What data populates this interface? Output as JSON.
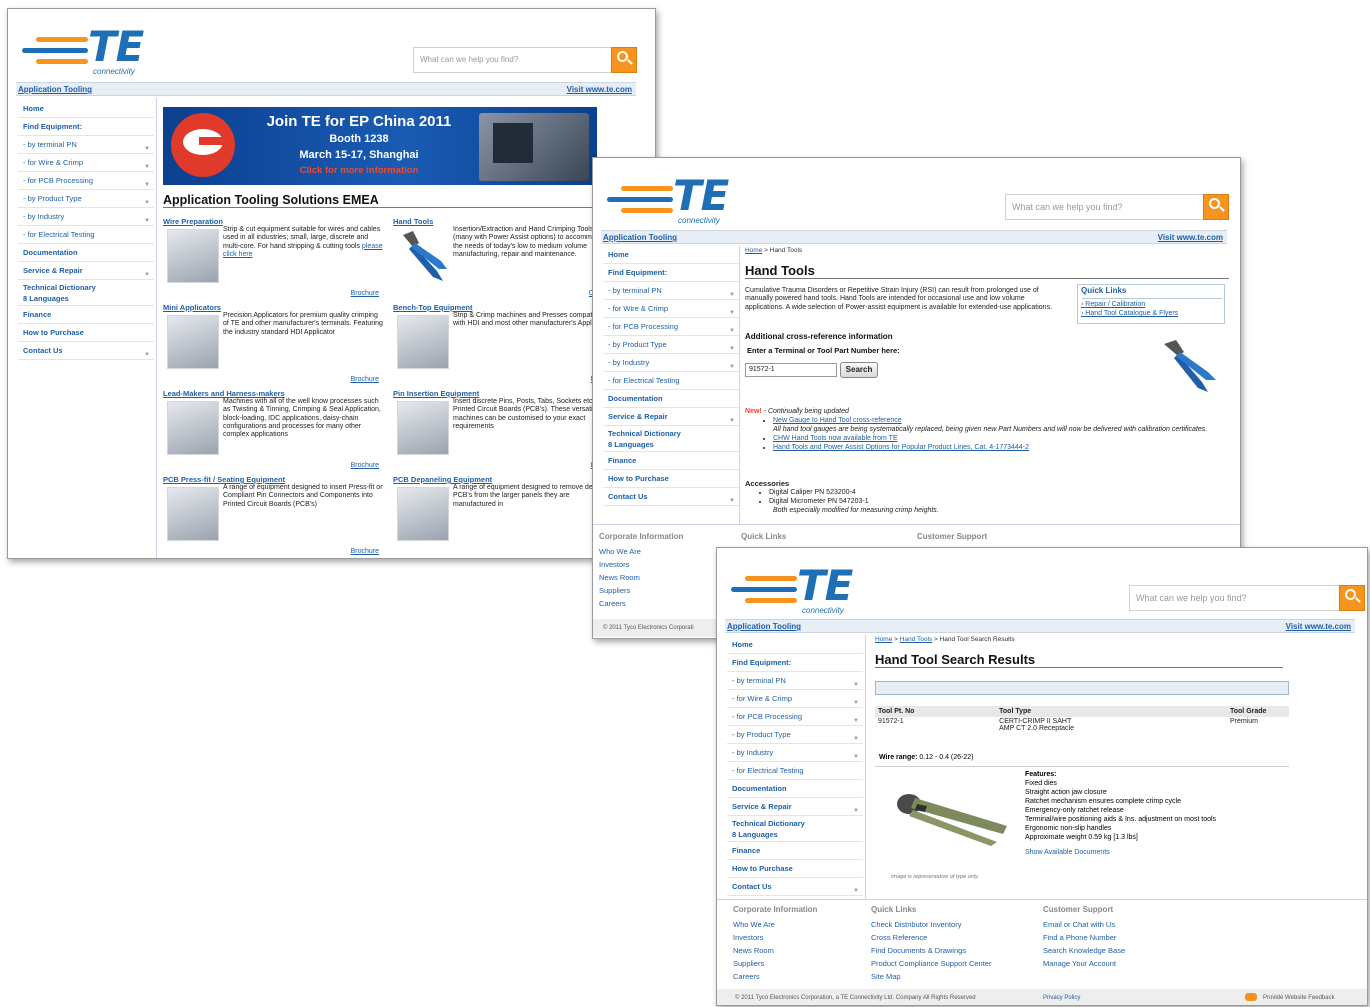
{
  "brand": {
    "logo_text": "TE",
    "tagline": "connectivity",
    "search_placeholder": "What can we help you find?"
  },
  "appbar": {
    "left": "Application Tooling",
    "right": "Visit www.te.com"
  },
  "sidebar": [
    {
      "label": "Home",
      "bold": true
    },
    {
      "label": "Find Equipment:",
      "bold": true
    },
    {
      "label": "- by terminal PN",
      "arrow": true
    },
    {
      "label": "- for Wire & Crimp",
      "arrow": true
    },
    {
      "label": "- for PCB Processing",
      "arrow": true
    },
    {
      "label": "- by Product Type",
      "arrow": true
    },
    {
      "label": "- by Industry",
      "arrow": true
    },
    {
      "label": "- for Electrical Testing"
    },
    {
      "label": "Documentation",
      "bold": true
    },
    {
      "label": "Service & Repair",
      "bold": true,
      "arrow": true
    },
    {
      "label": "Technical Dictionary\n8 Languages",
      "bold": true,
      "tall": true
    },
    {
      "label": "Finance",
      "bold": true
    },
    {
      "label": "How to Purchase",
      "bold": true
    },
    {
      "label": "Contact Us",
      "bold": true,
      "arrow": true
    }
  ],
  "window1": {
    "banner": {
      "line1": "Join TE for EP China 2011",
      "line2": "Booth 1238",
      "line3": "March 15-17, Shanghai",
      "line4": "Click for more information"
    },
    "heading": "Application Tooling Solutions EMEA",
    "cards": [
      {
        "title": "Wire Preparation",
        "text": "Strip & cut equipment suitable for wires and cables used in all industries; small, large, discrete and multi-core. For hand stripping & cutting tools",
        "link": "please click here",
        "brochure": "Brochure"
      },
      {
        "title": "Hand Tools",
        "text": "Insertion/Extraction and Hand Crimping Tools (many with Power Assist options) to accommodate the needs of today's low to medium volume manufacturing, repair and maintenance.",
        "link": "",
        "brochure": "Catalo"
      },
      {
        "title": "Mini Applicators",
        "text": "Precision Applicators for premium quality crimping of TE and other manufacturer's terminals. Featuring the industry standard HDI Applicator",
        "link": "",
        "brochure": "Brochure"
      },
      {
        "title": "Bench-Top Equipment",
        "text": "Strip & Crimp machines and Presses compatible with HDI and most other manufacturer's Applicators",
        "link": "",
        "brochure": "Broch"
      },
      {
        "title": "Lead-Makers and Harness-makers",
        "text": "Machines with all of the well know processes such as Twisting & Tinning, Crimping & Seal Application, block-loading, IDC applications, daisy-chain configurations and processes for many other complex applications",
        "link": "",
        "brochure": "Brochure"
      },
      {
        "title": "Pin Insertion Equipment",
        "text": "Insert discrete Pins, Posts, Tabs, Sockets etc into Printed Circuit Boards (PCB's). These versatile machines can be customised to your exact requirements",
        "link": "",
        "brochure": "Broch"
      },
      {
        "title": "PCB Press-fit / Seating Equipment",
        "text": "A range of equipment designed to insert Press-fit or Compliant Pin Connectors and Components into Printed Circuit Boards (PCB's)",
        "link": "",
        "brochure": "Brochure"
      },
      {
        "title": "PCB Depaneling Equipment",
        "text": "A range of equipment designed to remove descrete PCB's from the larger panels they are manufactured in",
        "link": "",
        "brochure": ""
      }
    ]
  },
  "window2": {
    "crumb_home": "Home",
    "crumb_rest": " > Hand Tools",
    "heading": "Hand Tools",
    "intro": "Cumulative Trauma Disorders or Repetitive Strain Injury (RSI) can result from prolonged use of manually powered hand tools. Hand Tools are intended for occasional use and low volume applications. A wide selection of Power-assist equipment is available for extended-use applications.",
    "quick_links": {
      "heading": "Quick Links",
      "items": [
        "Repair / Calibration",
        "Hand Tool Catalogue & Flyers"
      ]
    },
    "xref_heading": "Additional cross-reference information",
    "xref_prompt": "Enter a Terminal or Tool Part Number here:",
    "xref_value": "91572-1",
    "search_button": "Search",
    "new_tag": "New!",
    "updating": " - Continually being updated",
    "news": [
      {
        "link": "New Gauge to Hand Tool cross-reference",
        "extra": "All hand tool gauges are being systematically replaced, being given new Part Numbers and will now be delivered with calibration certificates."
      },
      {
        "link": "CHW Hand Tools now available from TE",
        "extra": ""
      },
      {
        "link": "Hand Tools and Power Assist Options for Popular Product Lines, Cat. 4-1773444-2",
        "extra": ""
      }
    ],
    "accessories_heading": "Accessories",
    "accessories": [
      "Digital Caliper PN 523200-4",
      "Digital Micrometer PN 547203-1"
    ],
    "accessories_note": "Both especially modified for measuring crimp heights.",
    "footer_heads": [
      "Corporate Information",
      "Quick Links",
      "Customer Support"
    ],
    "footer_links": [
      "Who We Are",
      "Investors",
      "News Room",
      "Suppliers",
      "Careers"
    ],
    "copyright": "© 2011 Tyco Electronics Corporati"
  },
  "window3": {
    "crumb_home": "Home",
    "crumb_mid": "Hand Tools",
    "crumb_rest": " > Hand Tool Search Results",
    "heading": "Hand Tool Search Results",
    "table": {
      "headers": [
        "Tool Pt. No",
        "Tool Type",
        "Tool Grade"
      ],
      "row": [
        "91572-1",
        "CERTI-CRIMP II SAHT\nAMP CT 2.0 Receptacle",
        "Premium"
      ]
    },
    "wire_label": "Wire range:",
    "wire_value": " 0.12 - 0.4 (26-22)",
    "features_heading": "Features:",
    "features": [
      "Fixed dies",
      "Straight action jaw closure",
      "Ratchet mechanism ensures complete crimp cycle",
      "Emergency-only ratchet release",
      "Terminal/wire positioning aids & Ins. adjustment on most tools",
      "Ergonomic non-slip handles",
      "Approximate weight 0.59 kg [1.3 lbs]"
    ],
    "show_docs": "Show Available Documents",
    "image_note": "Image is representative of type only.",
    "footer": {
      "cols": [
        {
          "head": "Corporate Information",
          "links": [
            "Who We Are",
            "Investors",
            "News Room",
            "Suppliers",
            "Careers"
          ]
        },
        {
          "head": "Quick Links",
          "links": [
            "Check Distributor Inventory",
            "Cross Reference",
            "Find Documents & Drawings",
            "Product Compliance Support Center",
            "Site Map"
          ]
        },
        {
          "head": "Customer Support",
          "links": [
            "Email or Chat with Us",
            "Find a Phone Number",
            "Search Knowledge Base",
            "Manage Your Account"
          ]
        }
      ],
      "copyright": "© 2011 Tyco Electronics Corporation, a TE Connectivity Ltd. Company All Rights Reserved",
      "privacy": "Privacy Policy",
      "feedback": "Provide Website Feedback"
    }
  }
}
